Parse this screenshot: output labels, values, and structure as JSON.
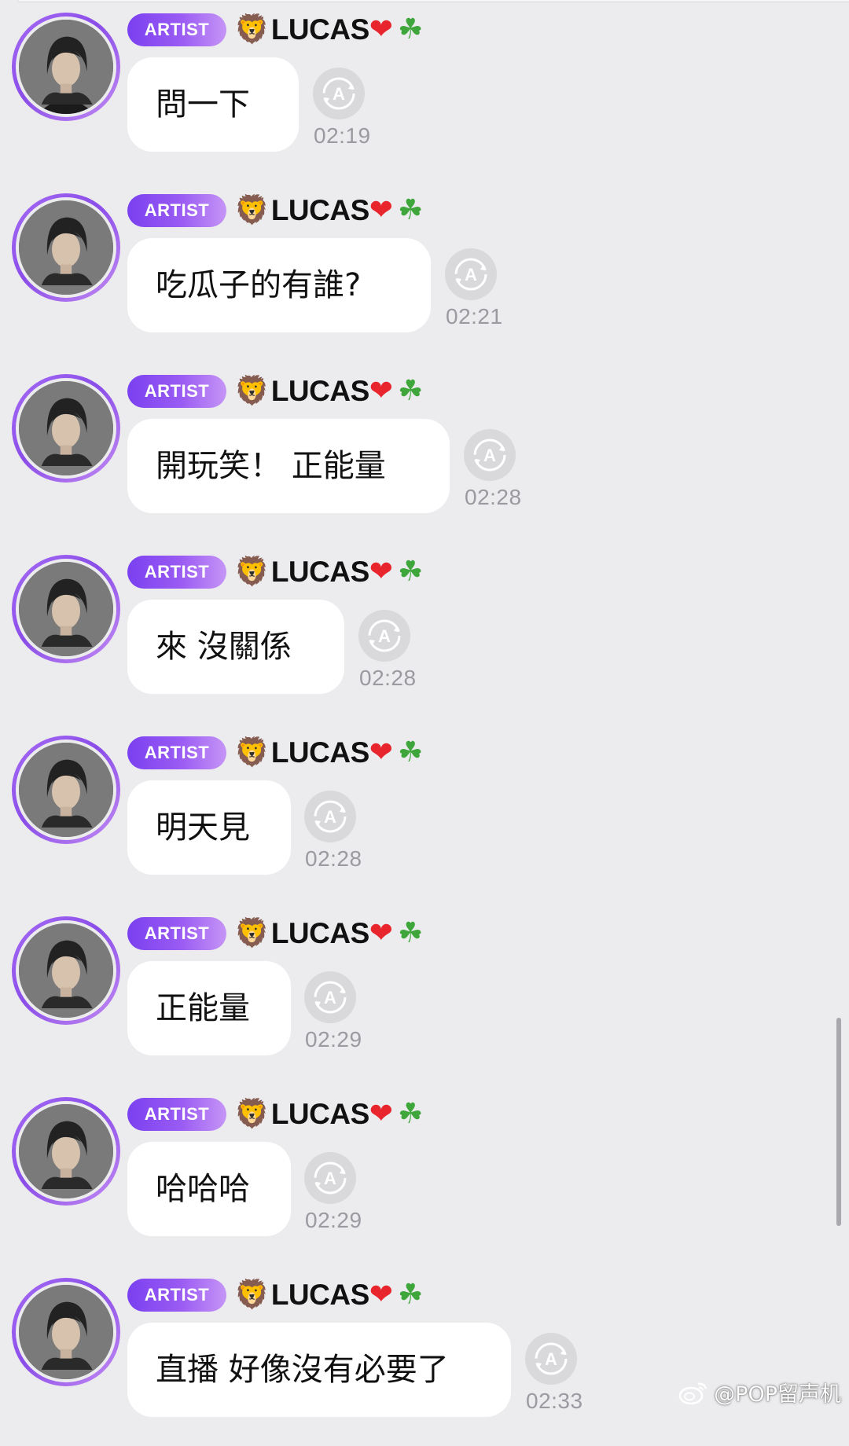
{
  "chat": {
    "badge_label": "ARTIST",
    "sender": {
      "prefix_emoji": "🦁",
      "name": "LUCAS",
      "suffix_emoji_1": "❤",
      "suffix_emoji_2": "☘"
    },
    "messages": [
      {
        "text": "問一下",
        "time": "02:19"
      },
      {
        "text": "吃瓜子的有誰?",
        "time": "02:21"
      },
      {
        "text": "開玩笑！ 正能量",
        "time": "02:28"
      },
      {
        "text": "來 沒關係",
        "time": "02:28"
      },
      {
        "text": "明天見",
        "time": "02:28"
      },
      {
        "text": "正能量",
        "time": "02:29"
      },
      {
        "text": "哈哈哈",
        "time": "02:29"
      },
      {
        "text": "直播 好像沒有必要了",
        "time": "02:33"
      }
    ]
  },
  "icons": {
    "translate": "translate-icon",
    "avatar": "artist-avatar"
  },
  "watermark": {
    "text": "@POP留声机",
    "icon": "weibo-icon"
  },
  "colors": {
    "background": "#ececee",
    "badge_start": "#7a40f0",
    "badge_end": "#c595f6",
    "bubble": "#ffffff",
    "timestamp": "#9a9aa0",
    "heart": "#e8242c",
    "clover": "#3ea63a"
  }
}
